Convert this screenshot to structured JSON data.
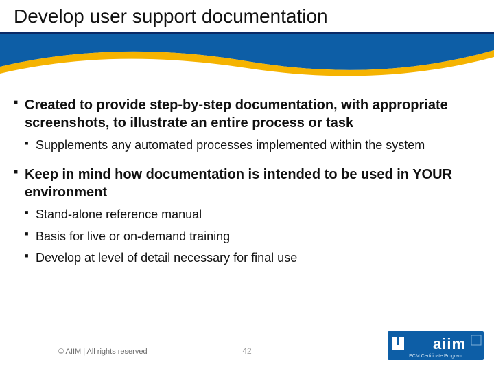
{
  "title": "Develop user support documentation",
  "bullets": [
    {
      "level": 1,
      "text": "Created to provide step-by-step documentation, with appropriate screenshots, to illustrate an entire process or task"
    },
    {
      "level": 2,
      "text": "Supplements any automated processes implemented within the system"
    },
    {
      "level": 1,
      "text": "Keep in mind how documentation is intended to be used in YOUR environment"
    },
    {
      "level": 2,
      "text": "Stand-alone reference manual"
    },
    {
      "level": 2,
      "text": "Basis for live or on-demand training"
    },
    {
      "level": 2,
      "text": "Develop at level of detail necessary for final use"
    }
  ],
  "footer": {
    "copyright": "© AIIM | All rights reserved",
    "page": "42",
    "logo_text_main": "aiim",
    "logo_text_sub": "ECM Certificate Program"
  },
  "colors": {
    "blue_dark": "#003a7a",
    "blue_mid": "#2b7cc0",
    "yellow": "#f5b301"
  }
}
